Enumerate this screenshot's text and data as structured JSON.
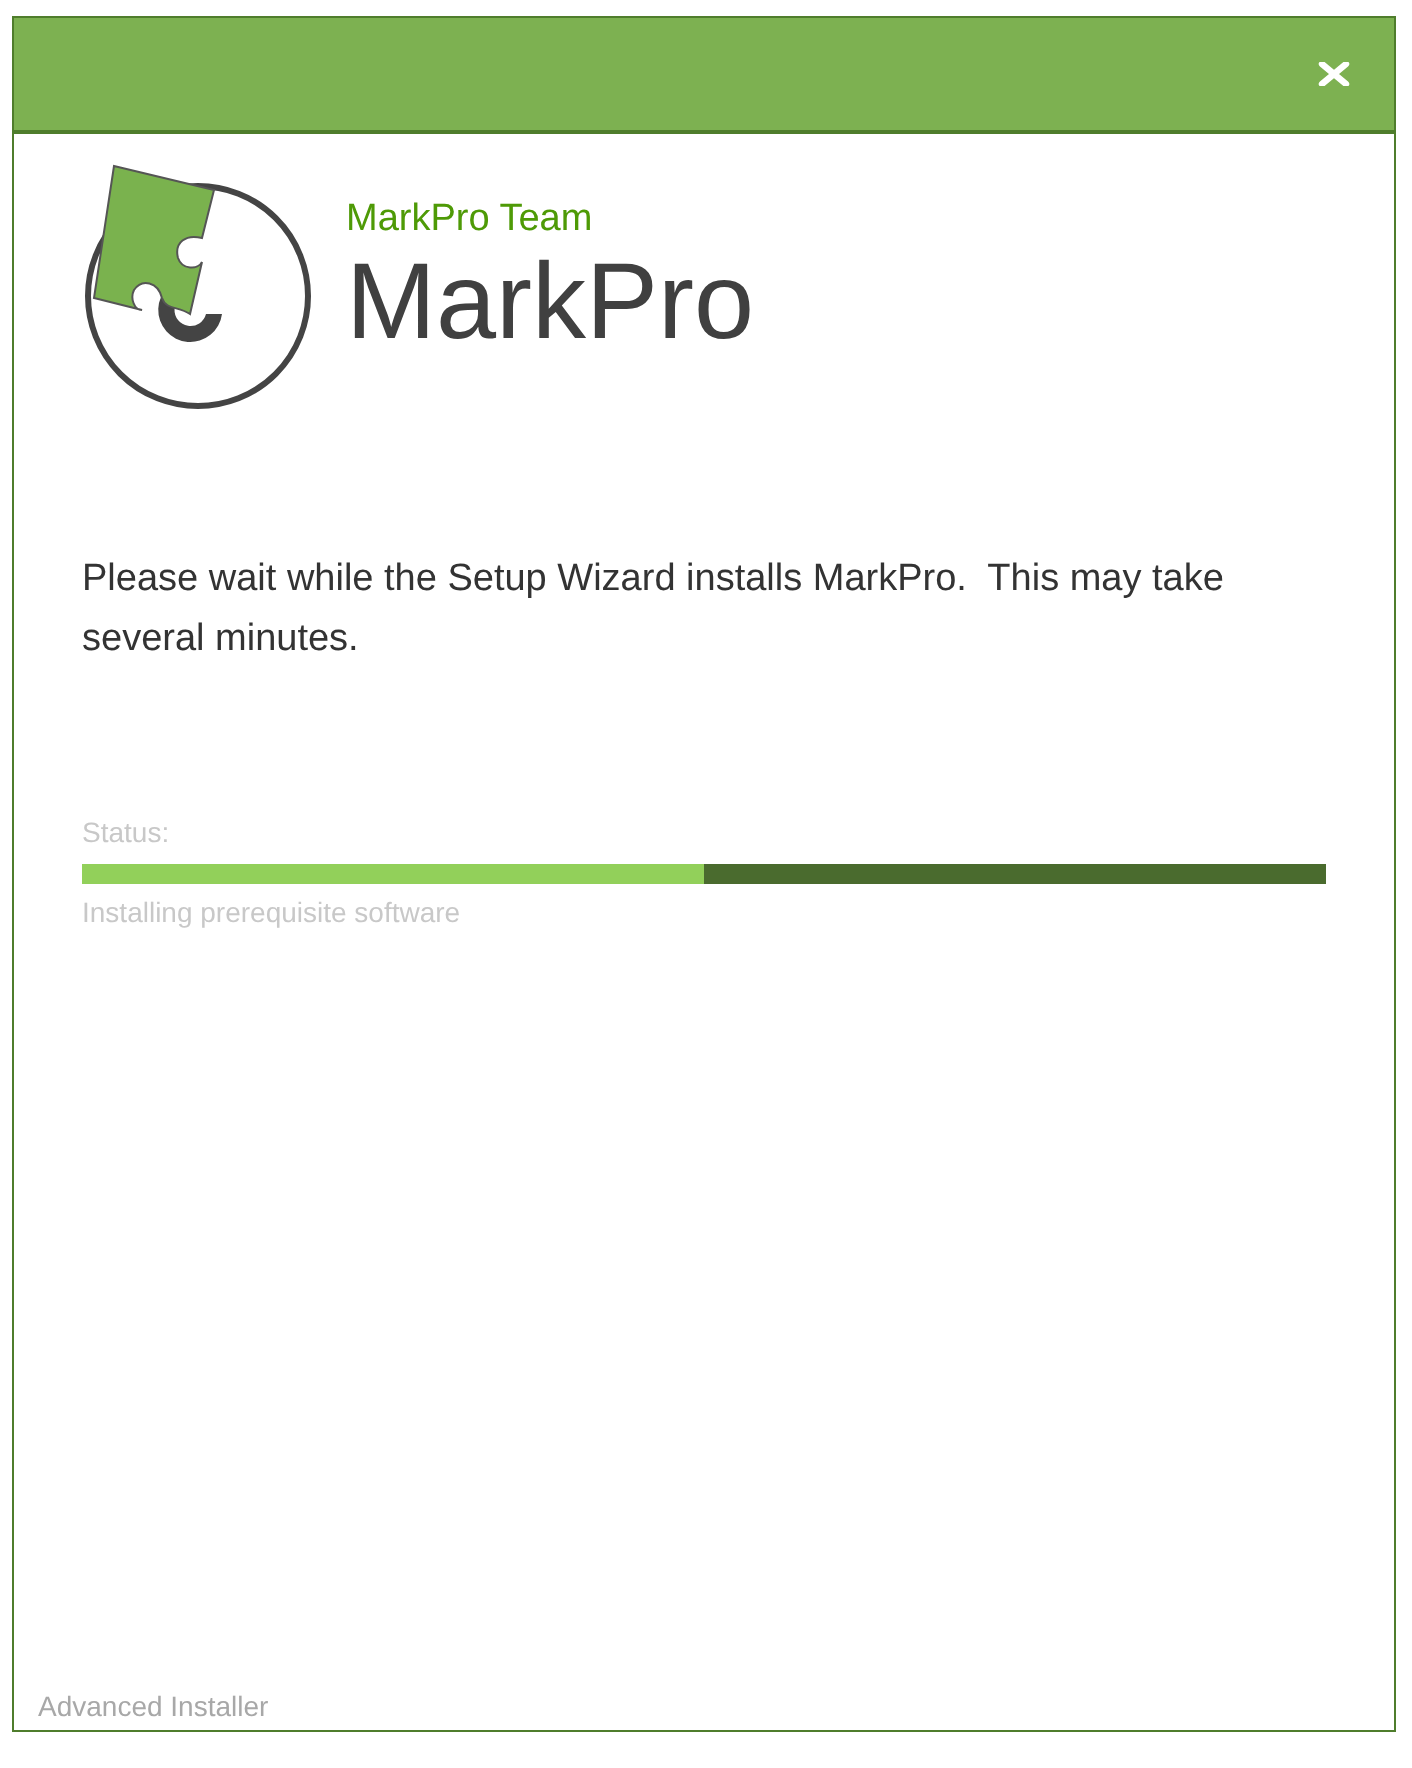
{
  "header": {
    "publisher": "MarkPro Team",
    "product": "MarkPro"
  },
  "message": "Please wait while the Setup Wizard installs MarkPro.  This may take several minutes.",
  "status": {
    "label": "Status:",
    "level": 0.5,
    "detail": "Installing prerequisite software"
  },
  "footer": "Advanced Installer"
}
